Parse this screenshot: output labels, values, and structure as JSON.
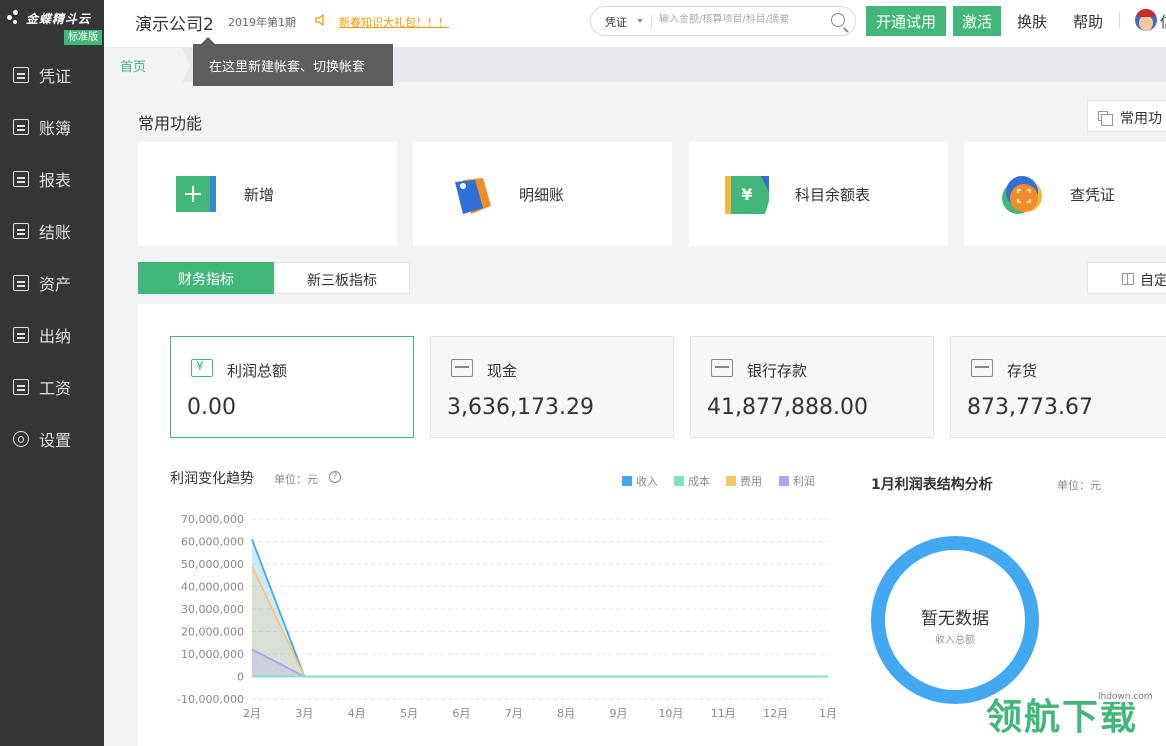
{
  "app": {
    "logo_text": "金蝶精斗云",
    "edition_badge": "标准版"
  },
  "sidebar": {
    "items": [
      {
        "label": "凭证"
      },
      {
        "label": "账簿"
      },
      {
        "label": "报表"
      },
      {
        "label": "结账"
      },
      {
        "label": "资产"
      },
      {
        "label": "出纳"
      },
      {
        "label": "工资"
      },
      {
        "label": "设置"
      }
    ]
  },
  "header": {
    "company": "演示公司2",
    "period": "2019年第1期",
    "promo": "新春知识大礼包！！！",
    "search_type": "凭证",
    "search_placeholder": "输入金额/核算项目/科目/摘要",
    "trial_button": "开通试用",
    "activate_button": "激活",
    "skin_link": "换肤",
    "help_link": "帮助",
    "user_fragment": "信"
  },
  "tabbar": {
    "home_tab": "首页",
    "tooltip": "在这里新建帐套、切换帐套"
  },
  "common": {
    "title": "常用功能",
    "settings_button": "常用功",
    "cards": [
      {
        "label": "新增",
        "icon": "add-icon"
      },
      {
        "label": "明细账",
        "icon": "tag-icon"
      },
      {
        "label": "科目余额表",
        "icon": "yuan-icon"
      },
      {
        "label": "查凭证",
        "icon": "scan-icon"
      }
    ]
  },
  "indicator_tabs": {
    "active": "财务指标",
    "inactive": "新三板指标",
    "custom_button": "自定"
  },
  "kpis": [
    {
      "title": "利润总额",
      "value": "0.00"
    },
    {
      "title": "现金",
      "value": "3,636,173.29"
    },
    {
      "title": "银行存款",
      "value": "41,877,888.00"
    },
    {
      "title": "存货",
      "value": "873,773.67"
    }
  ],
  "trend": {
    "title": "利润变化趋势",
    "unit": "单位：元",
    "help": "?"
  },
  "colors": {
    "accent": "#43b77a",
    "income": "#43a8f2",
    "cost": "#7fe0c8",
    "expense": "#f5c96b",
    "profit": "#a9a2ee"
  },
  "chart_data": {
    "type": "area",
    "categories": [
      "2月",
      "3月",
      "4月",
      "5月",
      "6月",
      "7月",
      "8月",
      "9月",
      "10月",
      "11月",
      "12月",
      "1月"
    ],
    "y_ticks": [
      "70,000,000",
      "60,000,000",
      "50,000,000",
      "40,000,000",
      "30,000,000",
      "20,000,000",
      "10,000,000",
      "0",
      "-10,000,000"
    ],
    "ylim": [
      -10000000,
      70000000
    ],
    "series": [
      {
        "name": "收入",
        "color": "#43a8f2",
        "values": [
          61000000,
          0,
          0,
          0,
          0,
          0,
          0,
          0,
          0,
          0,
          0,
          0
        ]
      },
      {
        "name": "成本",
        "color": "#7fe0c8",
        "values": [
          0,
          0,
          0,
          0,
          0,
          0,
          0,
          0,
          0,
          0,
          0,
          0
        ]
      },
      {
        "name": "费用",
        "color": "#f5c96b",
        "values": [
          49000000,
          0,
          0,
          0,
          0,
          0,
          0,
          0,
          0,
          0,
          0,
          0
        ]
      },
      {
        "name": "利润",
        "color": "#a9a2ee",
        "values": [
          12000000,
          0,
          0,
          0,
          0,
          0,
          0,
          0,
          0,
          0,
          0,
          0
        ]
      }
    ],
    "grid": true,
    "legend": "top-right"
  },
  "structure": {
    "title": "1月利润表结构分析",
    "unit": "单位：元",
    "empty_main": "暂无数据",
    "empty_sub": "收入总额"
  },
  "watermark": {
    "text": "领航下载",
    "url": "lhdown.com"
  }
}
